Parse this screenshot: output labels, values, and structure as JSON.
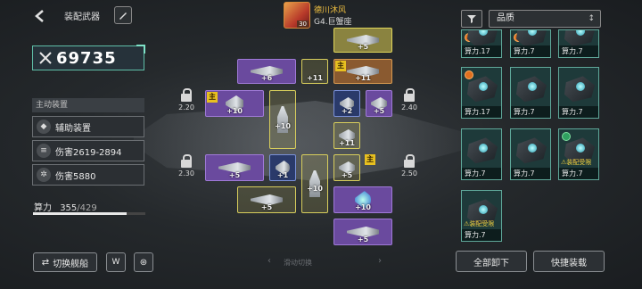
{
  "header": {
    "title": "装配武器"
  },
  "commander": {
    "name": "德川沐风",
    "rank": "G4.巨蟹座",
    "level": "30"
  },
  "left_panel": {
    "power": "69735",
    "section": "主动装置",
    "stats": [
      {
        "label": "辅助装置",
        "icon": "shield-icon"
      },
      {
        "label": "伤害2619-2894",
        "icon": "gun-icon"
      },
      {
        "label": "伤害5880",
        "icon": "gear-icon"
      }
    ],
    "compute_label": "算力",
    "compute_current": "355",
    "compute_max": "/429",
    "compute_fraction": 0.83
  },
  "bottom": {
    "switch_ship": "切换舰船",
    "swipe_hint": "滑动切换",
    "unload_all": "全部卸下",
    "quick_equip": "快捷装载"
  },
  "layout_locks": [
    {
      "value": "2.20"
    },
    {
      "value": "2.40"
    },
    {
      "value": "2.30"
    },
    {
      "value": "2.50"
    }
  ],
  "slots": [
    {
      "id": "top-a",
      "level": "+5"
    },
    {
      "id": "r1-a",
      "level": "+6"
    },
    {
      "id": "r1-b",
      "level": "+11"
    },
    {
      "id": "r1-c",
      "level": "+11",
      "main": "主"
    },
    {
      "id": "r2-a",
      "level": "+10",
      "main": "主"
    },
    {
      "id": "r2-b",
      "level": "+10"
    },
    {
      "id": "r2-c",
      "level": "+2"
    },
    {
      "id": "r2-d",
      "level": "+5"
    },
    {
      "id": "mid",
      "level": "+11"
    },
    {
      "id": "r3-a",
      "level": "+5"
    },
    {
      "id": "r3-b",
      "level": "+1"
    },
    {
      "id": "r3-c",
      "level": "+10"
    },
    {
      "id": "r3-d",
      "level": "+5",
      "main": "主"
    },
    {
      "id": "r4-a",
      "level": "+5"
    },
    {
      "id": "r4-b",
      "level": "+10"
    },
    {
      "id": "bot",
      "level": "+5"
    }
  ],
  "inventory": {
    "sort_label": "品质",
    "cards": [
      {
        "power": "算力.17"
      },
      {
        "power": "算力.7"
      },
      {
        "power": "算力.7"
      },
      {
        "power": "算力.17"
      },
      {
        "power": "算力.7"
      },
      {
        "power": "算力.7"
      },
      {
        "power": "算力.7"
      },
      {
        "power": "算力.7"
      },
      {
        "power": "算力.7",
        "warn": "装配受限"
      },
      {
        "power": "算力.7",
        "warn": "装配受限"
      }
    ]
  }
}
